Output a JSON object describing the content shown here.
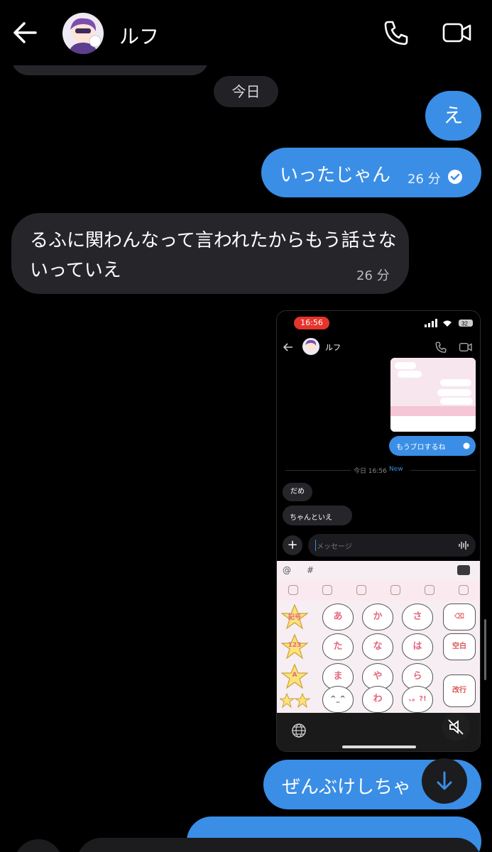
{
  "header": {
    "contact_name": "ルフ",
    "back_icon": "back-arrow-icon",
    "call_icon": "phone-icon",
    "video_icon": "video-camera-icon"
  },
  "date_divider": "今日",
  "messages": [
    {
      "direction": "out",
      "text": "え"
    },
    {
      "direction": "out",
      "text": "いったじゃん",
      "time": "26 分",
      "read": true
    },
    {
      "direction": "in",
      "text": "るふに関わんなって言われたからもう話さないっていえ",
      "time": "26 分"
    },
    {
      "direction": "out",
      "type": "image"
    },
    {
      "direction": "out",
      "text": "ぜんぶけしちゃ"
    }
  ],
  "embedded_screenshot": {
    "status_time": "16:56",
    "battery": "32",
    "contact_name": "ルフ",
    "sent_text": "もうブロするね",
    "divider_today": "今日 16:56",
    "divider_new": "New",
    "received": [
      "だめ",
      "ちゃんといえ"
    ],
    "input_placeholder": "メッセージ",
    "keyboard": {
      "top_left": "@",
      "top_hash": "#",
      "stars": [
        "記号",
        "123",
        "A"
      ],
      "row1": [
        "あ",
        "か",
        "さ"
      ],
      "row2": [
        "た",
        "な",
        "は"
      ],
      "row3": [
        "ま",
        "や",
        "ら"
      ],
      "row4": [
        "^_^",
        "わ",
        "、。?!"
      ],
      "side": [
        "⌫",
        "空白",
        "改行"
      ]
    }
  },
  "colors": {
    "outgoing": "#3a8ee6",
    "incoming": "#26252a",
    "background": "#000000"
  }
}
